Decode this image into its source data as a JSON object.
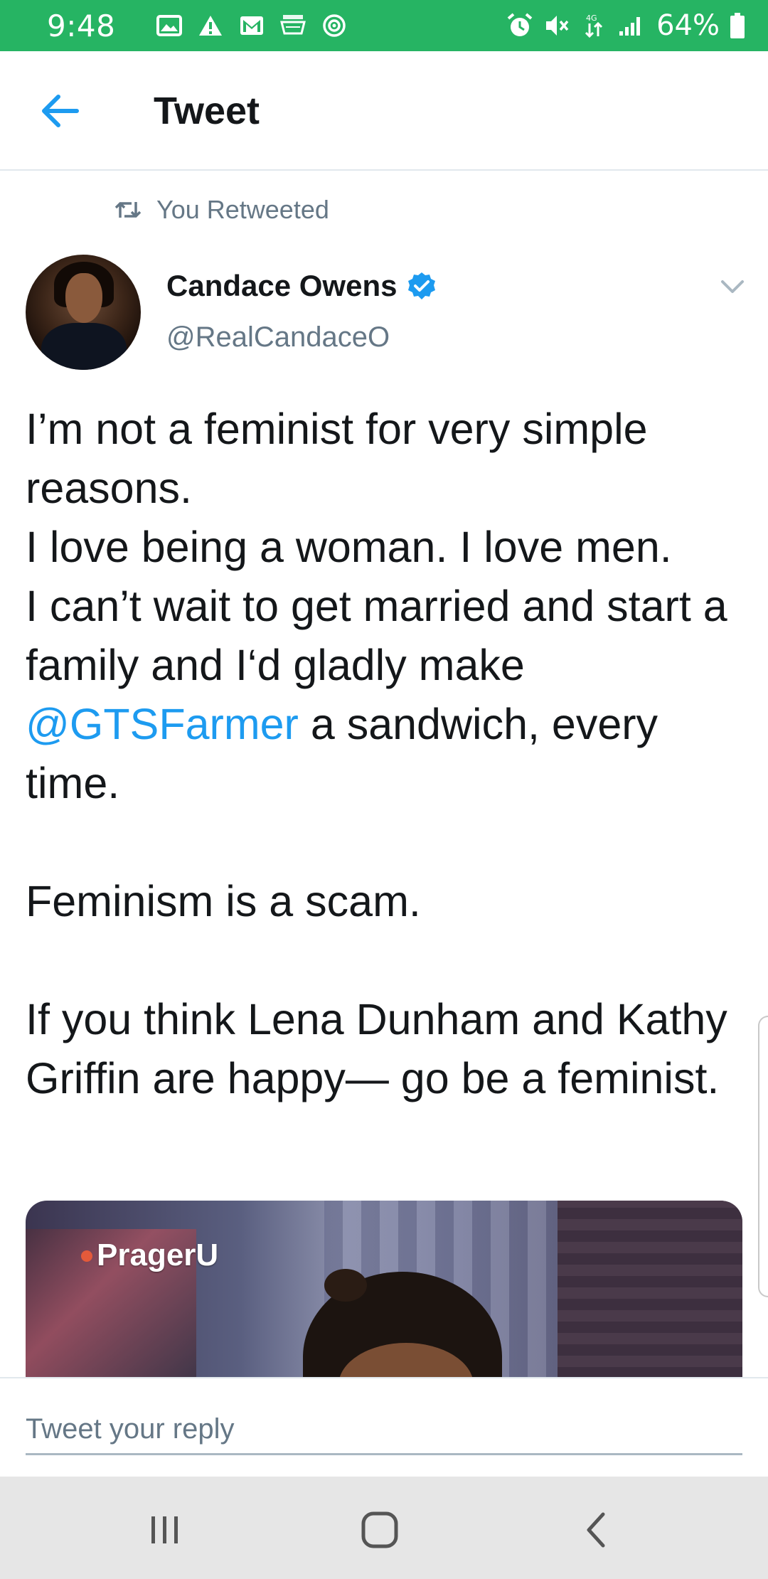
{
  "status_bar": {
    "time": "9:48",
    "battery_percent": "64%",
    "background": "#26b463",
    "left_icons": [
      "gallery-icon",
      "warning-icon",
      "gmail-icon",
      "amazon-icon",
      "sync-icon"
    ],
    "right_icons": [
      "alarm-icon",
      "mute-icon",
      "data-transfer-icon",
      "signal-icon",
      "battery-icon"
    ]
  },
  "header": {
    "title": "Tweet"
  },
  "retweet_context": {
    "label": "You Retweeted"
  },
  "author": {
    "name": "Candace Owens",
    "handle": "@RealCandaceO",
    "verified": true
  },
  "tweet": {
    "line1": "I’m not a feminist for very simple reasons.",
    "line2": "I love being a woman. I love men.",
    "line3_before": "I can’t wait to get married and start a family and I‘d gladly make ",
    "mention": "@GTSFarmer",
    "line3_after": " a sandwich, every time.",
    "line4": "Feminism is a scam.",
    "line5": "If you think Lena Dunham and Kathy Griffin are happy— go be a feminist."
  },
  "media": {
    "brand": "PragerU"
  },
  "reply": {
    "placeholder": "Tweet your reply"
  },
  "colors": {
    "accent": "#1d9bf0",
    "text": "#14171a",
    "secondary": "#657786"
  }
}
